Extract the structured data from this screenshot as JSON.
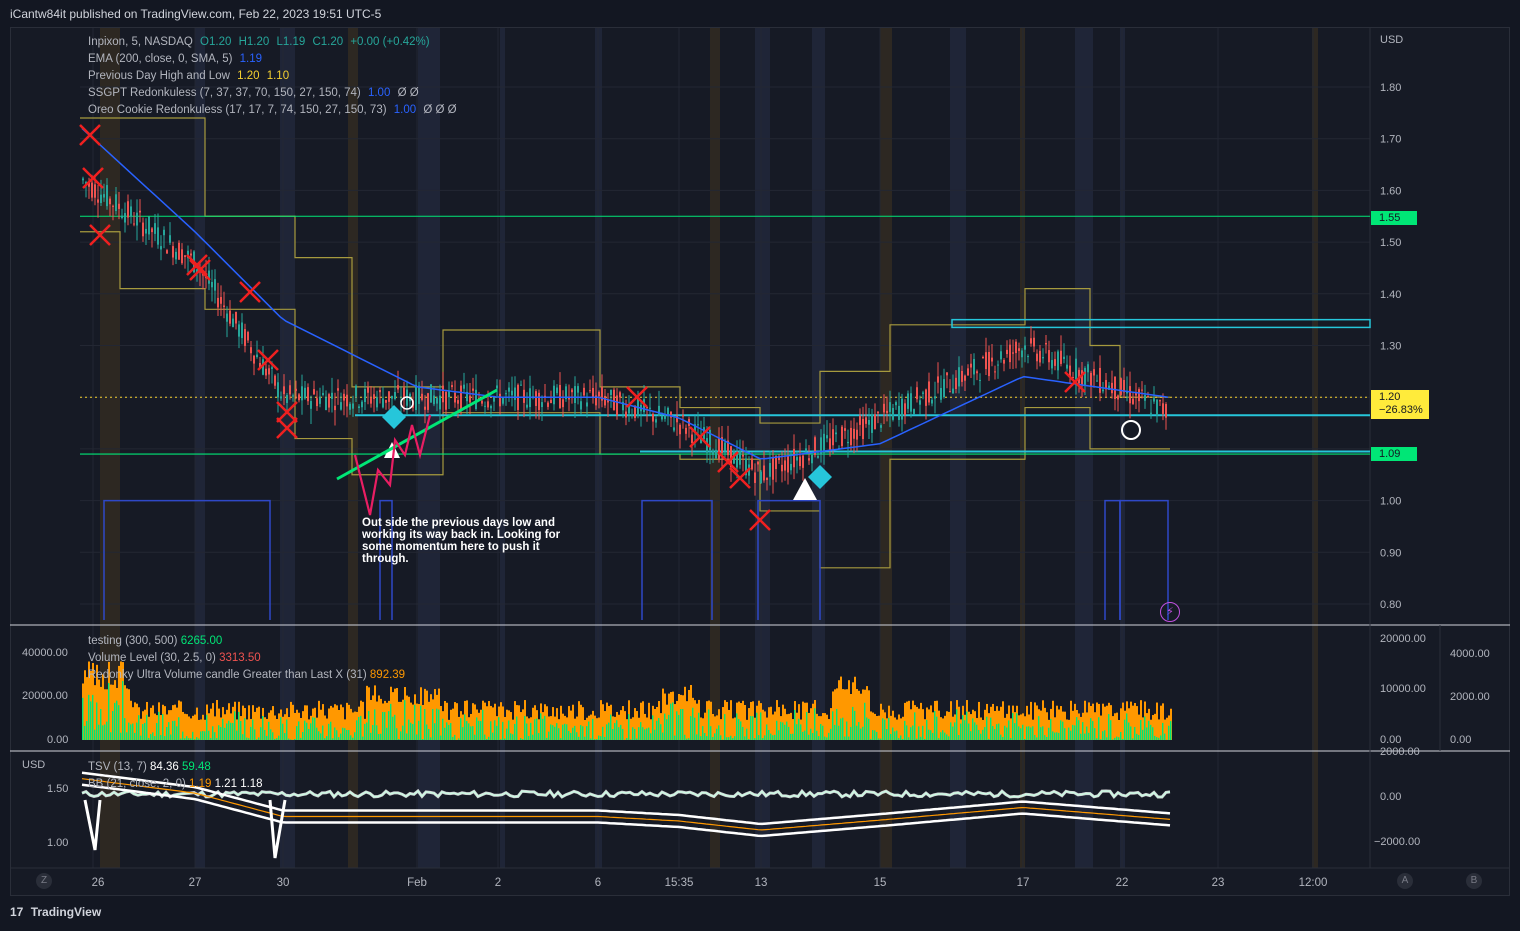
{
  "header": {
    "publish_text": "iCantw84it published on TradingView.com, Feb 22, 2023 19:51 UTC-5"
  },
  "legend": {
    "symbol_row": {
      "name": "Inpixon, 5, NASDAQ",
      "o": "O1.20",
      "h": "H1.20",
      "l": "L1.19",
      "c": "C1.20",
      "chg": "+0.00 (+0.42%)"
    },
    "ema": {
      "label": "EMA (200, close, 0, SMA, 5)",
      "value": "1.19"
    },
    "pdhl": {
      "label": "Previous Day High and Low",
      "v1": "1.20",
      "v2": "1.10"
    },
    "ssgpt": {
      "label": "SSGPT Redonkuless (7, 37, 37, 70, 150, 27, 150, 74)",
      "value": "1.00",
      "extra": "Ø  Ø"
    },
    "oreo": {
      "label": "Oreo Cookie Redonkuless (17, 17, 7, 74, 150, 27, 150, 73)",
      "value": "1.00",
      "extra": "Ø  Ø  Ø"
    }
  },
  "volume_legend": {
    "testing": {
      "label": "testing (300, 500)",
      "value": "6265.00"
    },
    "volume_level": {
      "label": "Volume Level (30, 2.5, 0)",
      "value": "3313.50"
    },
    "redonky": {
      "label": "Redonky Ultra Volume candle Greater than Last X (31)",
      "value": "892.39"
    }
  },
  "osc_legend": {
    "tsv": {
      "label": "TSV (13, 7)",
      "v1": "84.36",
      "v2": "59.48"
    },
    "bb": {
      "label": "BB (21, close, 2, 0)",
      "v1": "1.19",
      "v2": "1.21",
      "v3": "1.18"
    }
  },
  "annotation": {
    "text": "Out side the previous days low and working its way back in. Looking for some momentum here to push it through."
  },
  "price_axis": {
    "currency": "USD",
    "ticks": [
      "1.80",
      "1.70",
      "1.60",
      "1.50",
      "1.40",
      "1.30",
      "1.00",
      "0.90",
      "0.80"
    ],
    "badges": {
      "resistance": "1.55",
      "last": "1.20",
      "last_change": "−26.83%",
      "support": "1.09"
    }
  },
  "volume_axis": {
    "left_ticks": [
      "40000.00",
      "20000.00",
      "0.00"
    ],
    "mid_ticks": [
      "20000.00",
      "10000.00",
      "0.00"
    ],
    "right_ticks": [
      "4000.00",
      "2000.00",
      "0.00"
    ]
  },
  "osc_axis": {
    "left_currency": "USD",
    "left_ticks": [
      "1.50",
      "1.00"
    ],
    "right_ticks": [
      "2000.00",
      "0.00",
      "−2000.00"
    ]
  },
  "time_axis": {
    "labels": [
      "26",
      "27",
      "30",
      "Feb",
      "2",
      "6",
      "15:35",
      "13",
      "15",
      "17",
      "22",
      "23",
      "12:00"
    ]
  },
  "footer": {
    "brand": "TradingView",
    "logo_mark": "17"
  },
  "buttons": {
    "z": "Z",
    "a": "A",
    "b": "B"
  },
  "colors": {
    "background": "#161a25",
    "candle_up": "#26a69a",
    "candle_down": "#ef5350",
    "ema": "#2962ff",
    "pdhl": "#b5a642",
    "support_resistance": "#00e676",
    "cyan_zone": "#26c6da",
    "volume_orange": "#ff9800",
    "volume_green": "#00e676"
  },
  "chart_data": {
    "type": "line",
    "title": "",
    "symbol": "Inpixon, 5, NASDAQ",
    "x": [
      "26",
      "27",
      "30",
      "Feb",
      "2",
      "6",
      "15:35",
      "13",
      "15",
      "17",
      "22"
    ],
    "series": [
      {
        "name": "",
        "values": [
          1.62,
          1.46,
          1.2,
          1.2,
          1.2,
          1.2,
          1.15,
          1.05,
          1.16,
          1.3,
          1.17
        ]
      },
      {
        "name": "EMA (200, close, 0, SMA, 5)",
        "values": [
          1.72,
          1.52,
          1.35,
          1.22,
          1.2,
          1.2,
          1.16,
          1.08,
          1.11,
          1.24,
          1.2
        ]
      }
    ],
    "horizontal_levels": [
      1.55,
      1.09,
      1.2
    ],
    "ylim": [
      0.75,
      1.88
    ],
    "ylabel": "USD"
  }
}
